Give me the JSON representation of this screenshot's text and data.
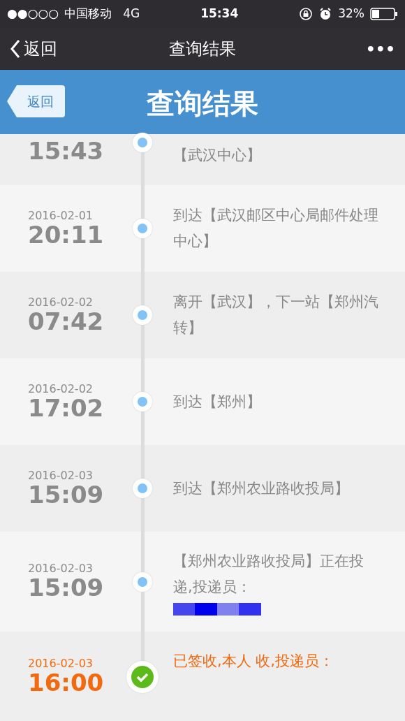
{
  "status_bar": {
    "signal_dots": "●●○○○",
    "carrier": "中国移动",
    "network": "4G",
    "time": "15:34",
    "battery": "32%"
  },
  "nav": {
    "back": "返回",
    "title": "查询结果",
    "more": "•••"
  },
  "header": {
    "back": "返回",
    "title": "查询结果"
  },
  "events": [
    {
      "kind": "transit",
      "partial": true,
      "time": "15:43",
      "text": "【武汉中心】"
    },
    {
      "kind": "transit",
      "date": "2016-02-01",
      "time": "20:11",
      "text": "到达【武汉邮区中心局邮件处理中心】"
    },
    {
      "kind": "transit",
      "date": "2016-02-02",
      "time": "07:42",
      "text": "离开【武汉】，下一站【郑州汽转】"
    },
    {
      "kind": "transit",
      "date": "2016-02-02",
      "time": "17:02",
      "text": "到达【郑州】"
    },
    {
      "kind": "transit",
      "date": "2016-02-03",
      "time": "15:09",
      "text": "到达【郑州农业路收投局】"
    },
    {
      "kind": "transit",
      "date": "2016-02-03",
      "time": "15:09",
      "text": "【郑州农业路收投局】正在投递,投递员：",
      "redacted": true
    },
    {
      "kind": "delivered",
      "date": "2016-02-03",
      "time": "16:00",
      "text": "已签收,本人 收,投递员："
    }
  ]
}
